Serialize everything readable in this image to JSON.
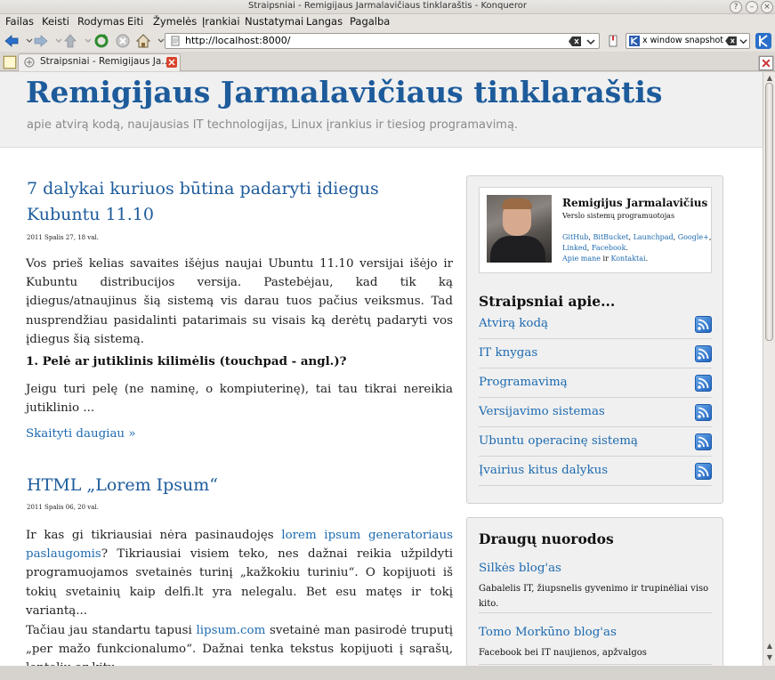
{
  "window": {
    "title": "Straipsniai - Remigijaus Jarmalavičiaus tinklaraštis - Konqueror"
  },
  "menu": [
    "Failas",
    "Keisti",
    "Rodymas",
    "Eiti",
    "Žymelės",
    "Įrankiai",
    "Nustatymai",
    "Langas",
    "Pagalba"
  ],
  "toolbar": {
    "url": "http://localhost:8000/",
    "search_text": "x window snapshot"
  },
  "tab": {
    "label": "Straipsniai - Remigijaus Ja..."
  },
  "site": {
    "title": "Remigijaus Jarmalavičiaus tinklaraštis",
    "subtitle": "apie atvirą kodą, naujausias IT technologijas, Linux įrankius ir tiesiog programavimą."
  },
  "posts": [
    {
      "title": "7 dalykai kuriuos būtina padaryti įdiegus Kubuntu 11.10",
      "date": "2011 Spalis 27, 18 val.",
      "paragraph": "Vos prieš kelias savaites išėjus naujai Ubuntu 11.10 versijai išėjo ir Kubuntu distribucijos versija. Pastebėjau, kad tik ką įdiegus/atnaujinus šią sistemą vis darau tuos pačius veiksmus. Tad nusprendžiau pasidalinti patarimais su visais ką derėtų padaryti vos įdiegus šią sistemą.",
      "subheading": "1. Pelė ar jutiklinis kilimėlis (touchpad - angl.)?",
      "paragraph2": "Jeigu turi pelę (ne naminę, o kompiuterinę), tai tau tikrai nereikia jutiklinio ...",
      "read_more": "Skaityti daugiau »"
    },
    {
      "title": "HTML „Lorem Ipsum“",
      "date": "2011 Spalis 06, 20 val.",
      "p1_before": "Ir kas gi tikriausiai nėra pasinaudojęs ",
      "p1_link": "lorem ipsum generatoriaus paslaugomis",
      "p1_after": "? Tikriausiai visiem teko, nes dažnai reikia užpildyti programuojamos svetainės turinį „kažkokiu turiniu“. O kopijuoti iš tokių svetainių kaip delfi.lt yra nelegalu. Bet esu matęs ir tokį variantą...",
      "p2_before": "Tačiau jau standartu tapusi ",
      "p2_link": "lipsum.com",
      "p2_after": " svetainė man pasirodė truputį „per mažo funkcionalumo“. Dažnai tenka tekstus kopijuoti į sąrašų, lentelių ar kitu"
    }
  ],
  "profile": {
    "name": "Remigijus Jarmalavičius",
    "role": "Verslo sistemų programuotojas",
    "links": [
      "GitHub",
      "BitBucket",
      "Launchpad",
      "Google+",
      "Linked",
      "Facebook"
    ],
    "about": "Apie mane",
    "and": "ir",
    "contacts": "Kontaktai"
  },
  "categories": {
    "heading": "Straipsniai apie...",
    "items": [
      "Atvirą kodą",
      "IT knygas",
      "Programavimą",
      "Versijavimo sistemas",
      "Ubuntu operacinę sistemą",
      "Įvairius kitus dalykus"
    ]
  },
  "friends": {
    "heading": "Draugų nuorodos",
    "items": [
      {
        "name": "Silkės blog'as",
        "desc": "Gabalelis IT, žiupsnelis gyvenimo ir trupinėliai viso kito."
      },
      {
        "name": "Tomo Morkūno blog'as",
        "desc": "Facebook bei IT naujienos, apžvalgos"
      }
    ]
  }
}
